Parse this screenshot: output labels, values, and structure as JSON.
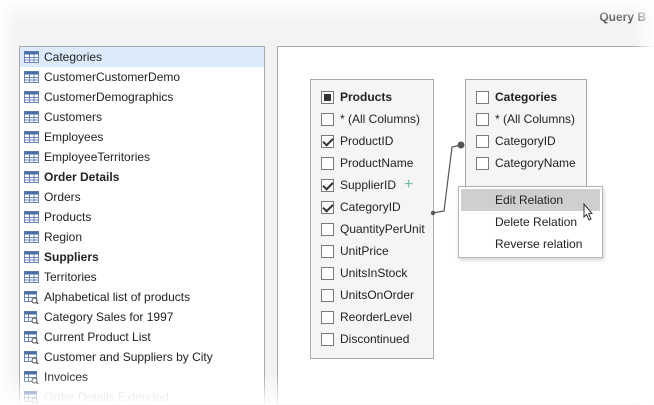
{
  "window": {
    "title": "Query B"
  },
  "tables": [
    {
      "label": "Categories",
      "kind": "table",
      "selected": true,
      "bold": false
    },
    {
      "label": "CustomerCustomerDemo",
      "kind": "table",
      "selected": false,
      "bold": false
    },
    {
      "label": "CustomerDemographics",
      "kind": "table",
      "selected": false,
      "bold": false
    },
    {
      "label": "Customers",
      "kind": "table",
      "selected": false,
      "bold": false
    },
    {
      "label": "Employees",
      "kind": "table",
      "selected": false,
      "bold": false
    },
    {
      "label": "EmployeeTerritories",
      "kind": "table",
      "selected": false,
      "bold": false
    },
    {
      "label": "Order Details",
      "kind": "table",
      "selected": false,
      "bold": true
    },
    {
      "label": "Orders",
      "kind": "table",
      "selected": false,
      "bold": false
    },
    {
      "label": "Products",
      "kind": "table",
      "selected": false,
      "bold": false
    },
    {
      "label": "Region",
      "kind": "table",
      "selected": false,
      "bold": false
    },
    {
      "label": "Suppliers",
      "kind": "table",
      "selected": false,
      "bold": true
    },
    {
      "label": "Territories",
      "kind": "table",
      "selected": false,
      "bold": false
    },
    {
      "label": "Alphabetical list of products",
      "kind": "view",
      "selected": false,
      "bold": false
    },
    {
      "label": "Category Sales for 1997",
      "kind": "view",
      "selected": false,
      "bold": false
    },
    {
      "label": "Current Product List",
      "kind": "view",
      "selected": false,
      "bold": false
    },
    {
      "label": "Customer and Suppliers by City",
      "kind": "view",
      "selected": false,
      "bold": false
    },
    {
      "label": "Invoices",
      "kind": "view",
      "selected": false,
      "bold": false
    },
    {
      "label": "Order Details Extended",
      "kind": "view",
      "selected": false,
      "bold": false
    }
  ],
  "products": {
    "title": "Products",
    "fields": [
      {
        "label": "* (All Columns)",
        "checked": false
      },
      {
        "label": "ProductID",
        "checked": true
      },
      {
        "label": "ProductName",
        "checked": false
      },
      {
        "label": "SupplierID",
        "checked": true
      },
      {
        "label": "CategoryID",
        "checked": true
      },
      {
        "label": "QuantityPerUnit",
        "checked": false
      },
      {
        "label": "UnitPrice",
        "checked": false
      },
      {
        "label": "UnitsInStock",
        "checked": false
      },
      {
        "label": "UnitsOnOrder",
        "checked": false
      },
      {
        "label": "ReorderLevel",
        "checked": false
      },
      {
        "label": "Discontinued",
        "checked": false
      }
    ]
  },
  "categories": {
    "title": "Categories",
    "fields": [
      {
        "label": "* (All Columns)",
        "checked": false
      },
      {
        "label": "CategoryID",
        "checked": false
      },
      {
        "label": "CategoryName",
        "checked": false
      }
    ]
  },
  "context_menu": {
    "items": [
      {
        "label": "Edit Relation",
        "hover": true
      },
      {
        "label": "Delete Relation",
        "hover": false
      },
      {
        "label": "Reverse relation",
        "hover": false
      }
    ]
  },
  "colors": {
    "selection": "#dcebfb",
    "menu_hover": "#cfcfcf",
    "table_icon_header": "#4a6fa5",
    "plus": "#7fb8a0"
  }
}
